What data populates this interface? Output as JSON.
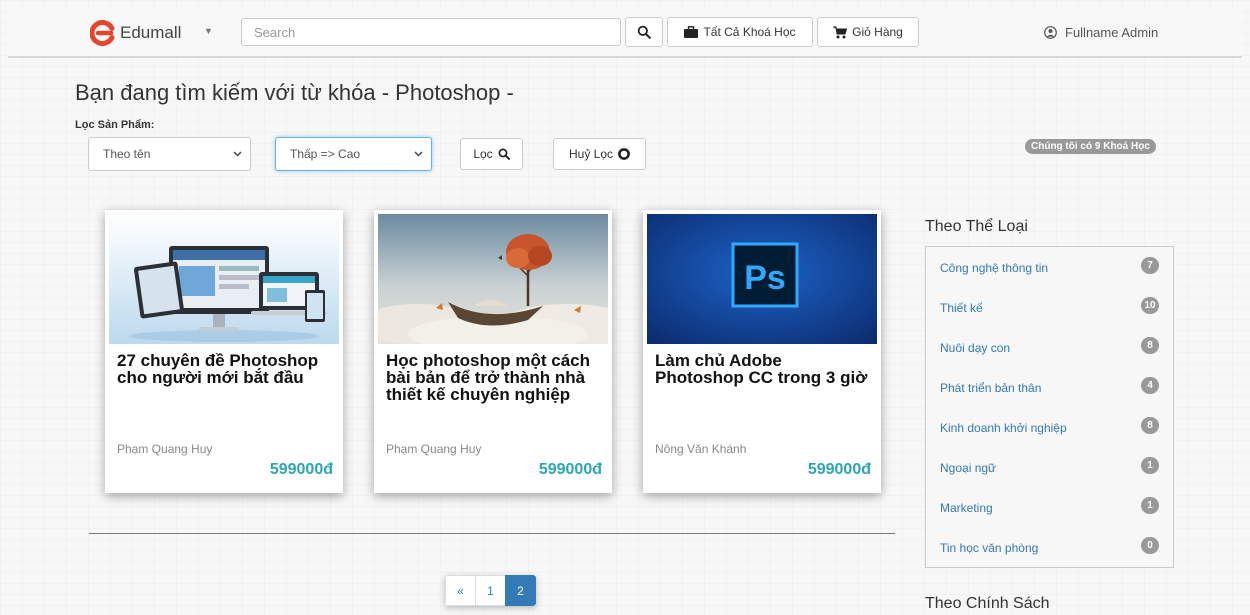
{
  "colors": {
    "accent": "#337ab7",
    "price": "#2ba6b5",
    "brand": "#e4452f",
    "badge": "#999999"
  },
  "header": {
    "brand": "Edumall",
    "search_placeholder": "Search",
    "all_courses": "Tất Cả Khoá Học",
    "cart": "Giỏ Hàng",
    "user": "Fullname Admin"
  },
  "search": {
    "title": "Bạn đang tìm kiếm với từ khóa - Photoshop -",
    "filter_label": "Lọc Sản Phẩm:",
    "sort_name": "Theo tên",
    "sort_price": "Thấp => Cao",
    "filter_button": "Lọc",
    "clear_button": "Huỷ Lọc",
    "count_badge": "Chúng tôi có 9 Khoá Học"
  },
  "courses": [
    {
      "title": "27 chuyên đề Photoshop cho người mới bắt đầu",
      "author": "Phạm Quang Huy",
      "price": "599000đ",
      "image": "monitors-illustration"
    },
    {
      "title": "Học photoshop một cách bài bản để trở thành nhà thiết kế chuyên nghiệp",
      "author": "Phạm Quang Huy",
      "price": "599000đ",
      "image": "surreal-boat-tree"
    },
    {
      "title": "Làm chủ Adobe Photoshop CC trong 3 giờ",
      "author": "Nông Văn Khánh",
      "price": "599000đ",
      "image": "photoshop-logo",
      "image_text": "Ps"
    }
  ],
  "pagination": {
    "prev": "«",
    "pages": [
      "1",
      "2"
    ],
    "current": "2"
  },
  "sidebar": {
    "category_title": "Theo Thể Loại",
    "categories": [
      {
        "name": "Công nghệ thông tin",
        "count": "7"
      },
      {
        "name": "Thiết kế",
        "count": "10"
      },
      {
        "name": "Nuôi dạy con",
        "count": "8"
      },
      {
        "name": "Phát triển bản thân",
        "count": "4"
      },
      {
        "name": "Kinh doanh khởi nghiệp",
        "count": "8"
      },
      {
        "name": "Ngoại ngữ",
        "count": "1"
      },
      {
        "name": "Marketing",
        "count": "1"
      },
      {
        "name": "Tin học văn phòng",
        "count": "0"
      }
    ],
    "policy_title": "Theo Chính Sách"
  }
}
